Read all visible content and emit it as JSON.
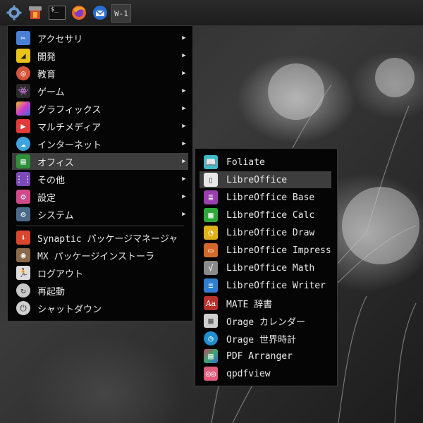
{
  "panel": {
    "launchers": [
      {
        "icon": "gear-icon"
      },
      {
        "icon": "synaptic-icon"
      },
      {
        "icon": "terminal-icon",
        "text": "$_"
      },
      {
        "icon": "firefox-icon"
      },
      {
        "icon": "thunderbird-icon"
      }
    ],
    "workspace_label": "W-1"
  },
  "main_menu": {
    "items": [
      {
        "label": "アクセサリ",
        "icon": "accessories-icon",
        "color": "#4a7fd6",
        "submenu": true
      },
      {
        "label": "開発",
        "icon": "development-icon",
        "color": "#e8c21a",
        "submenu": true
      },
      {
        "label": "教育",
        "icon": "education-icon",
        "color": "#d6553a",
        "submenu": true
      },
      {
        "label": "ゲーム",
        "icon": "games-icon",
        "color": "#2a2a2a",
        "submenu": true
      },
      {
        "label": "グラフィックス",
        "icon": "graphics-icon",
        "color": "#c23fd6",
        "submenu": true
      },
      {
        "label": "マルチメディア",
        "icon": "multimedia-icon",
        "color": "#e03a3a",
        "submenu": true
      },
      {
        "label": "インターネット",
        "icon": "internet-icon",
        "color": "#3fa3e0",
        "submenu": true
      },
      {
        "label": "オフィス",
        "icon": "office-icon",
        "color": "#2f8f3a",
        "submenu": true,
        "selected": true
      },
      {
        "label": "その他",
        "icon": "other-icon",
        "color": "#7a4ab8",
        "submenu": true
      },
      {
        "label": "設定",
        "icon": "settings-icon",
        "color": "#d04a8a",
        "submenu": true
      },
      {
        "label": "システム",
        "icon": "system-icon",
        "color": "#4a6a8a",
        "submenu": true
      }
    ],
    "actions": [
      {
        "label": "Synaptic パッケージマネージャ",
        "icon": "synaptic-icon",
        "color": "#d9472e"
      },
      {
        "label": "MX パッケージインストーラ",
        "icon": "mx-installer-icon",
        "color": "#8a6a4a"
      },
      {
        "label": "ログアウト",
        "icon": "logout-icon",
        "color": "#dcdcdc"
      },
      {
        "label": "再起動",
        "icon": "restart-icon",
        "color": "#c8c8c8"
      },
      {
        "label": "シャットダウン",
        "icon": "shutdown-icon",
        "color": "#cfcfcf"
      }
    ]
  },
  "office_submenu": {
    "items": [
      {
        "label": "Foliate",
        "icon": "foliate-icon",
        "color": "#3fb8c8"
      },
      {
        "label": "LibreOffice",
        "icon": "libreoffice-icon",
        "color": "#e8e8e8",
        "selected": true
      },
      {
        "label": "LibreOffice Base",
        "icon": "libreoffice-base-icon",
        "color": "#9b3fb0"
      },
      {
        "label": "LibreOffice Calc",
        "icon": "libreoffice-calc-icon",
        "color": "#2fa83a"
      },
      {
        "label": "LibreOffice Draw",
        "icon": "libreoffice-draw-icon",
        "color": "#e0b21a"
      },
      {
        "label": "LibreOffice Impress",
        "icon": "libreoffice-impress-icon",
        "color": "#d4682a"
      },
      {
        "label": "LibreOffice Math",
        "icon": "libreoffice-math-icon",
        "color": "#8a8a8a"
      },
      {
        "label": "LibreOffice Writer",
        "icon": "libreoffice-writer-icon",
        "color": "#2f7fd0"
      },
      {
        "label": "MATE 辞書",
        "icon": "dictionary-icon",
        "color": "#b8302a"
      },
      {
        "label": "Orage カレンダー",
        "icon": "calendar-icon",
        "color": "#cfcfcf"
      },
      {
        "label": "Orage 世界時計",
        "icon": "clock-icon",
        "color": "#1f8fd0"
      },
      {
        "label": "PDF Arranger",
        "icon": "pdf-arranger-icon",
        "color": "#c83a6a"
      },
      {
        "label": "qpdfview",
        "icon": "qpdfview-icon",
        "color": "#e05a7a"
      }
    ]
  }
}
